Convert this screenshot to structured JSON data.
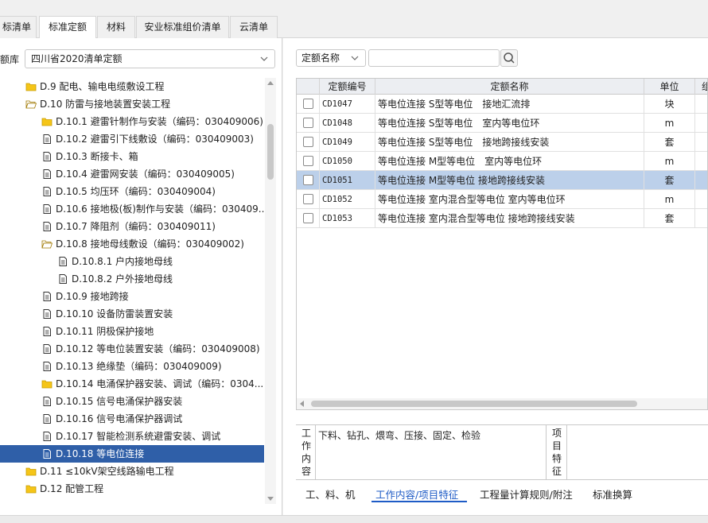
{
  "tabs": [
    {
      "label": "标清单"
    },
    {
      "label": "标准定额",
      "active": true
    },
    {
      "label": "材料"
    },
    {
      "label": "安业标准组价清单"
    },
    {
      "label": "云清单"
    }
  ],
  "left_panel": {
    "library_label": "额库",
    "library_value": "四川省2020清单定额",
    "tree": [
      {
        "label": "D.9 配电、输电电缆敷设工程",
        "icon": "folder-closed-icon"
      },
      {
        "label": "D.10 防雷与接地装置安装工程",
        "icon": "folder-open-icon"
      },
      {
        "label": "D.10.1 避雷针制作与安装（编码：030409006)",
        "icon": "folder-closed-icon"
      },
      {
        "label": "D.10.2 避雷引下线敷设（编码：030409003)",
        "icon": "document-icon"
      },
      {
        "label": "D.10.3 断接卡、箱",
        "icon": "document-icon"
      },
      {
        "label": "D.10.4 避雷网安装（编码：030409005)",
        "icon": "document-icon"
      },
      {
        "label": "D.10.5 均压环（编码：030409004)",
        "icon": "document-icon"
      },
      {
        "label": "D.10.6 接地极(板)制作与安装（编码：030409...",
        "icon": "document-icon"
      },
      {
        "label": "D.10.7 降阻剂（编码：030409011)",
        "icon": "document-icon"
      },
      {
        "label": "D.10.8 接地母线敷设（编码：030409002)",
        "icon": "folder-open-icon"
      },
      {
        "label": "D.10.8.1 户内接地母线",
        "icon": "document-icon"
      },
      {
        "label": "D.10.8.2 户外接地母线",
        "icon": "document-icon"
      },
      {
        "label": "D.10.9 接地跨接",
        "icon": "document-icon"
      },
      {
        "label": "D.10.10 设备防雷装置安装",
        "icon": "document-icon"
      },
      {
        "label": "D.10.11 阴极保护接地",
        "icon": "document-icon"
      },
      {
        "label": "D.10.12 等电位装置安装（编码：030409008)",
        "icon": "document-icon"
      },
      {
        "label": "D.10.13 绝缘垫（编码：030409009)",
        "icon": "document-icon"
      },
      {
        "label": "D.10.14 电涌保护器安装、调试（编码：0304...",
        "icon": "folder-closed-icon"
      },
      {
        "label": "D.10.15 信号电涌保护器安装",
        "icon": "document-icon"
      },
      {
        "label": "D.10.16 信号电涌保护器调试",
        "icon": "document-icon"
      },
      {
        "label": "D.10.17 智能检测系统避雷安装、调试",
        "icon": "document-icon"
      },
      {
        "label": "D.10.18 等电位连接",
        "icon": "document-icon",
        "selected": true
      },
      {
        "label": "D.11 ≤10kV架空线路输电工程",
        "icon": "folder-closed-icon"
      },
      {
        "label": "D.12 配管工程",
        "icon": "folder-closed-icon"
      }
    ]
  },
  "right_panel": {
    "filter_value": "定额名称",
    "search_value": "",
    "columns": [
      "定额编号",
      "定额名称",
      "单位",
      "组"
    ],
    "rows": [
      {
        "code": "CD1047",
        "name": "等电位连接 S型等电位　接地汇流排",
        "unit": "块"
      },
      {
        "code": "CD1048",
        "name": "等电位连接 S型等电位　室内等电位环",
        "unit": "m"
      },
      {
        "code": "CD1049",
        "name": "等电位连接 S型等电位　接地跨接线安装",
        "unit": "套"
      },
      {
        "code": "CD1050",
        "name": "等电位连接 M型等电位　室内等电位环",
        "unit": "m"
      },
      {
        "code": "CD1051",
        "name": "等电位连接 M型等电位 接地跨接线安装",
        "unit": "套",
        "selected": true
      },
      {
        "code": "CD1052",
        "name": "等电位连接 室内混合型等电位 室内等电位环",
        "unit": "m"
      },
      {
        "code": "CD1053",
        "name": "等电位连接 室内混合型等电位 接地跨接线安装",
        "unit": "套"
      }
    ],
    "work_label": "工作内容",
    "work_content": "下料、钻孔、煨弯、压接、固定、检验",
    "feature_label": "项目特征",
    "bottom_tabs": [
      {
        "label": "工、料、机"
      },
      {
        "label": "工作内容/项目特征",
        "active": true
      },
      {
        "label": "工程量计算规则/附注"
      },
      {
        "label": "标准换算"
      }
    ]
  },
  "colors": {
    "selected_tree": "#2f5fa8",
    "selected_row": "#bcd0ea",
    "accent": "#1e5bc6",
    "folder": "#f5c518"
  }
}
